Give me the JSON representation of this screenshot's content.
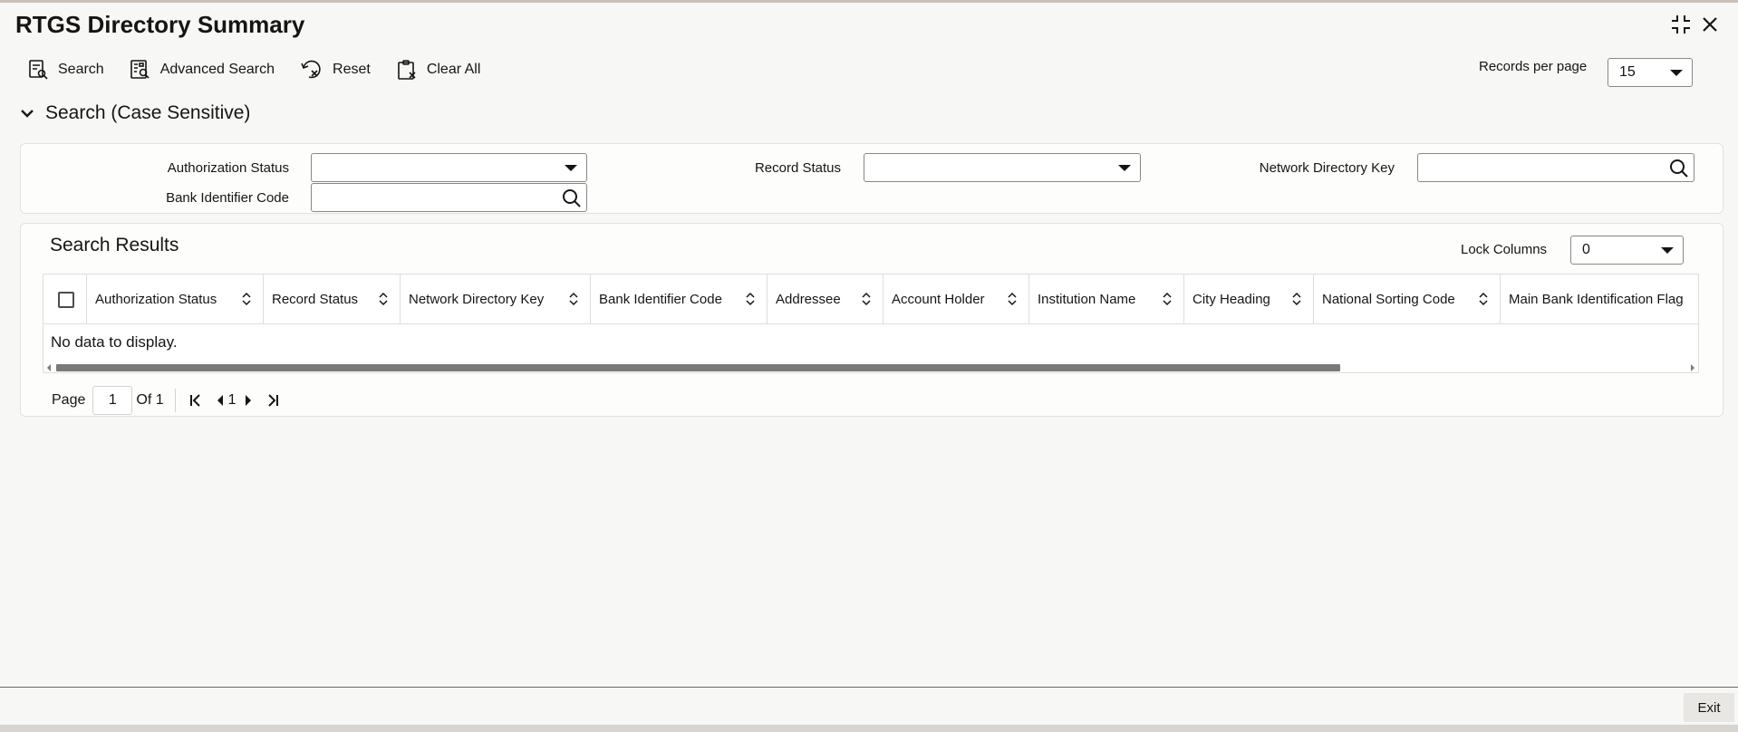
{
  "window": {
    "title": "RTGS Directory Summary"
  },
  "toolbar": {
    "search_label": "Search",
    "advanced_search_label": "Advanced Search",
    "reset_label": "Reset",
    "clear_all_label": "Clear All",
    "records_per_page_label": "Records per page",
    "records_per_page_value": "15"
  },
  "search_section": {
    "header": "Search (Case Sensitive)",
    "fields": {
      "authorization_status_label": "Authorization Status",
      "authorization_status_value": "",
      "record_status_label": "Record Status",
      "record_status_value": "",
      "network_directory_key_label": "Network Directory Key",
      "network_directory_key_value": "",
      "bank_identifier_code_label": "Bank Identifier Code",
      "bank_identifier_code_value": ""
    }
  },
  "results": {
    "title": "Search Results",
    "lock_columns_label": "Lock Columns",
    "lock_columns_value": "0",
    "columns": [
      "Authorization Status",
      "Record Status",
      "Network Directory Key",
      "Bank Identifier Code",
      "Addressee",
      "Account Holder",
      "Institution Name",
      "City Heading",
      "National Sorting Code",
      "Main Bank Identification Flag"
    ],
    "empty_message": "No data to display."
  },
  "pagination": {
    "page_label": "Page",
    "current_page": "1",
    "of_label": "Of 1",
    "page_number": "1"
  },
  "footer": {
    "exit_label": "Exit"
  }
}
